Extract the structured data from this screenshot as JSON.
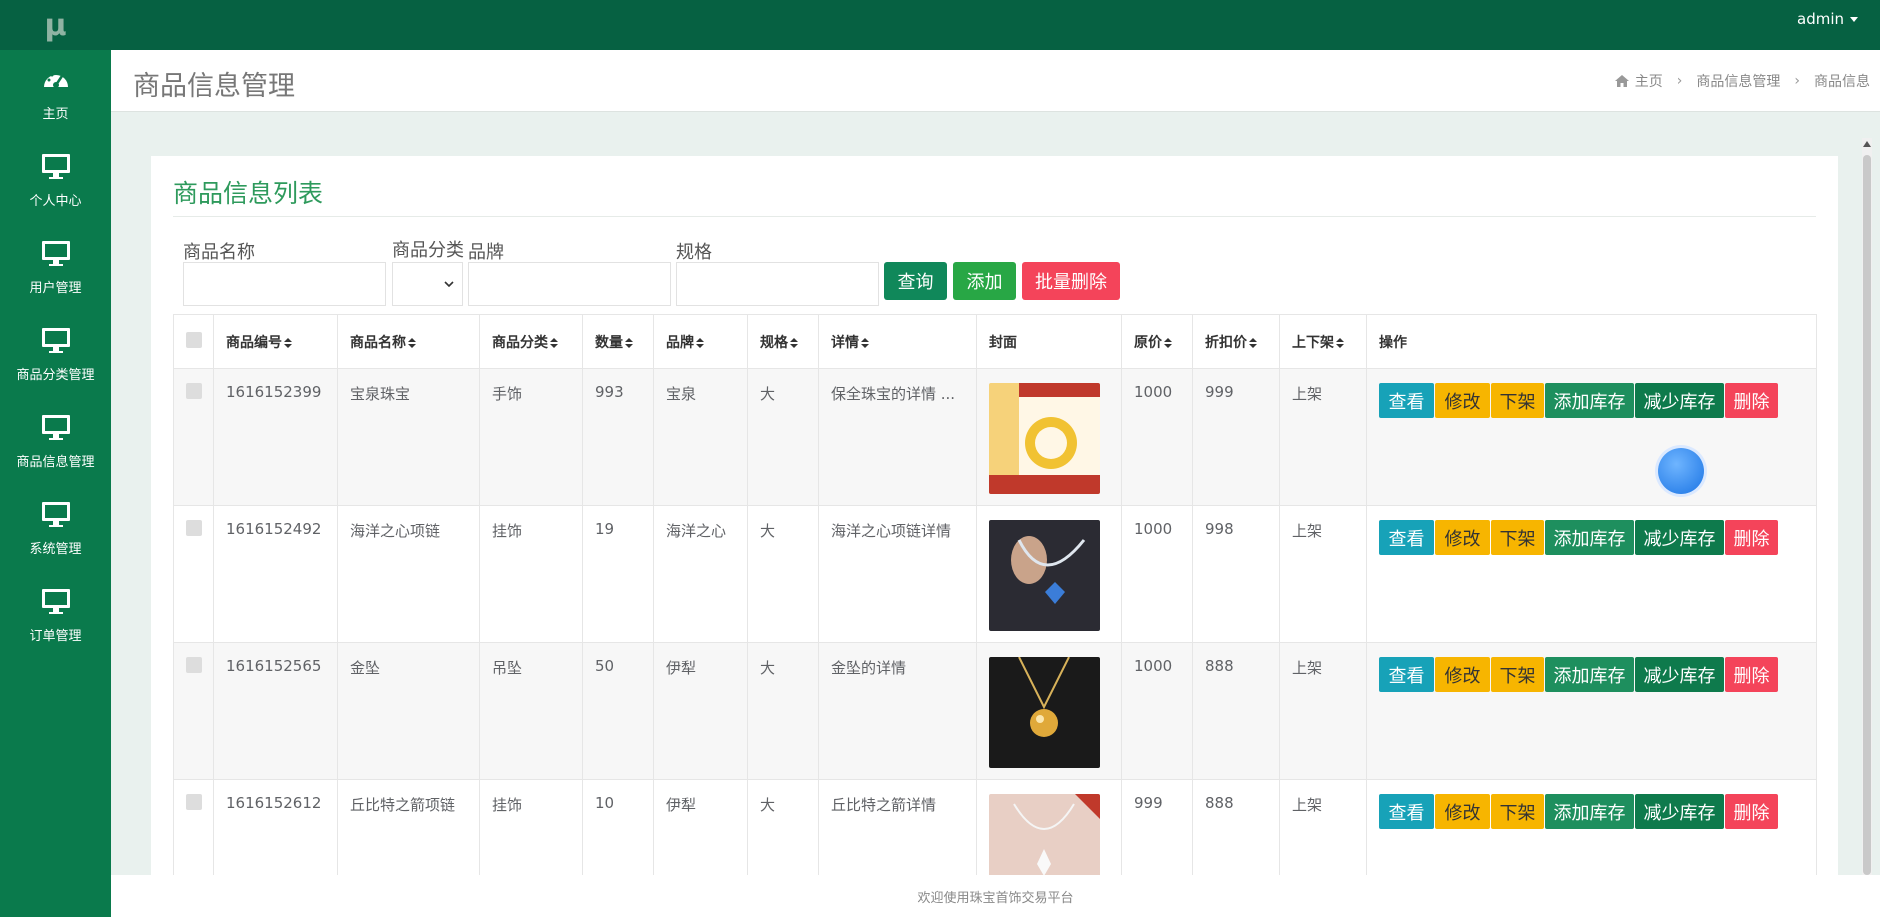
{
  "app": {
    "logo": "μ"
  },
  "topbar": {
    "user": "admin"
  },
  "sidebar": {
    "items": [
      {
        "label": "主页",
        "icon": "dashboard-icon"
      },
      {
        "label": "个人中心",
        "icon": "monitor-icon"
      },
      {
        "label": "用户管理",
        "icon": "monitor-icon"
      },
      {
        "label": "商品分类管理",
        "icon": "monitor-icon"
      },
      {
        "label": "商品信息管理",
        "icon": "monitor-icon"
      },
      {
        "label": "系统管理",
        "icon": "monitor-icon"
      },
      {
        "label": "订单管理",
        "icon": "monitor-icon"
      }
    ]
  },
  "header": {
    "title": "商品信息管理",
    "breadcrumb": [
      "主页",
      "商品信息管理",
      "商品信息"
    ]
  },
  "card": {
    "title": "商品信息列表"
  },
  "search": {
    "name_label": "商品名称",
    "category_label": "商品分类",
    "brand_label": "品牌",
    "spec_label": "规格",
    "query_btn": "查询",
    "add_btn": "添加",
    "batch_delete_btn": "批量删除"
  },
  "table": {
    "columns": [
      "商品编号",
      "商品名称",
      "商品分类",
      "数量",
      "品牌",
      "规格",
      "详情",
      "封面",
      "原价",
      "折扣价",
      "上下架",
      "操作"
    ],
    "actions": [
      "查看",
      "修改",
      "下架",
      "添加库存",
      "减少库存",
      "删除"
    ],
    "rows": [
      {
        "id": "1616152399",
        "name": "宝泉珠宝",
        "category": "手饰",
        "qty": "993",
        "brand": "宝泉",
        "spec": "大",
        "detail": "保全珠宝的详情 ...",
        "price": "1000",
        "discount": "999",
        "status": "上架",
        "cover": "#c0392b"
      },
      {
        "id": "1616152492",
        "name": "海洋之心项链",
        "category": "挂饰",
        "qty": "19",
        "brand": "海洋之心",
        "spec": "大",
        "detail": "海洋之心项链详情",
        "price": "1000",
        "discount": "998",
        "status": "上架",
        "cover": "#2b2b33"
      },
      {
        "id": "1616152565",
        "name": "金坠",
        "category": "吊坠",
        "qty": "50",
        "brand": "伊犁",
        "spec": "大",
        "detail": "金坠的详情",
        "price": "1000",
        "discount": "888",
        "status": "上架",
        "cover": "#1a1a1a"
      },
      {
        "id": "1616152612",
        "name": "丘比特之箭项链",
        "category": "挂饰",
        "qty": "10",
        "brand": "伊犁",
        "spec": "大",
        "detail": "丘比特之箭详情",
        "price": "999",
        "discount": "888",
        "status": "上架",
        "cover": "#e8cfc5"
      }
    ]
  },
  "footer": {
    "text": "欢迎使用珠宝首饰交易平台"
  }
}
